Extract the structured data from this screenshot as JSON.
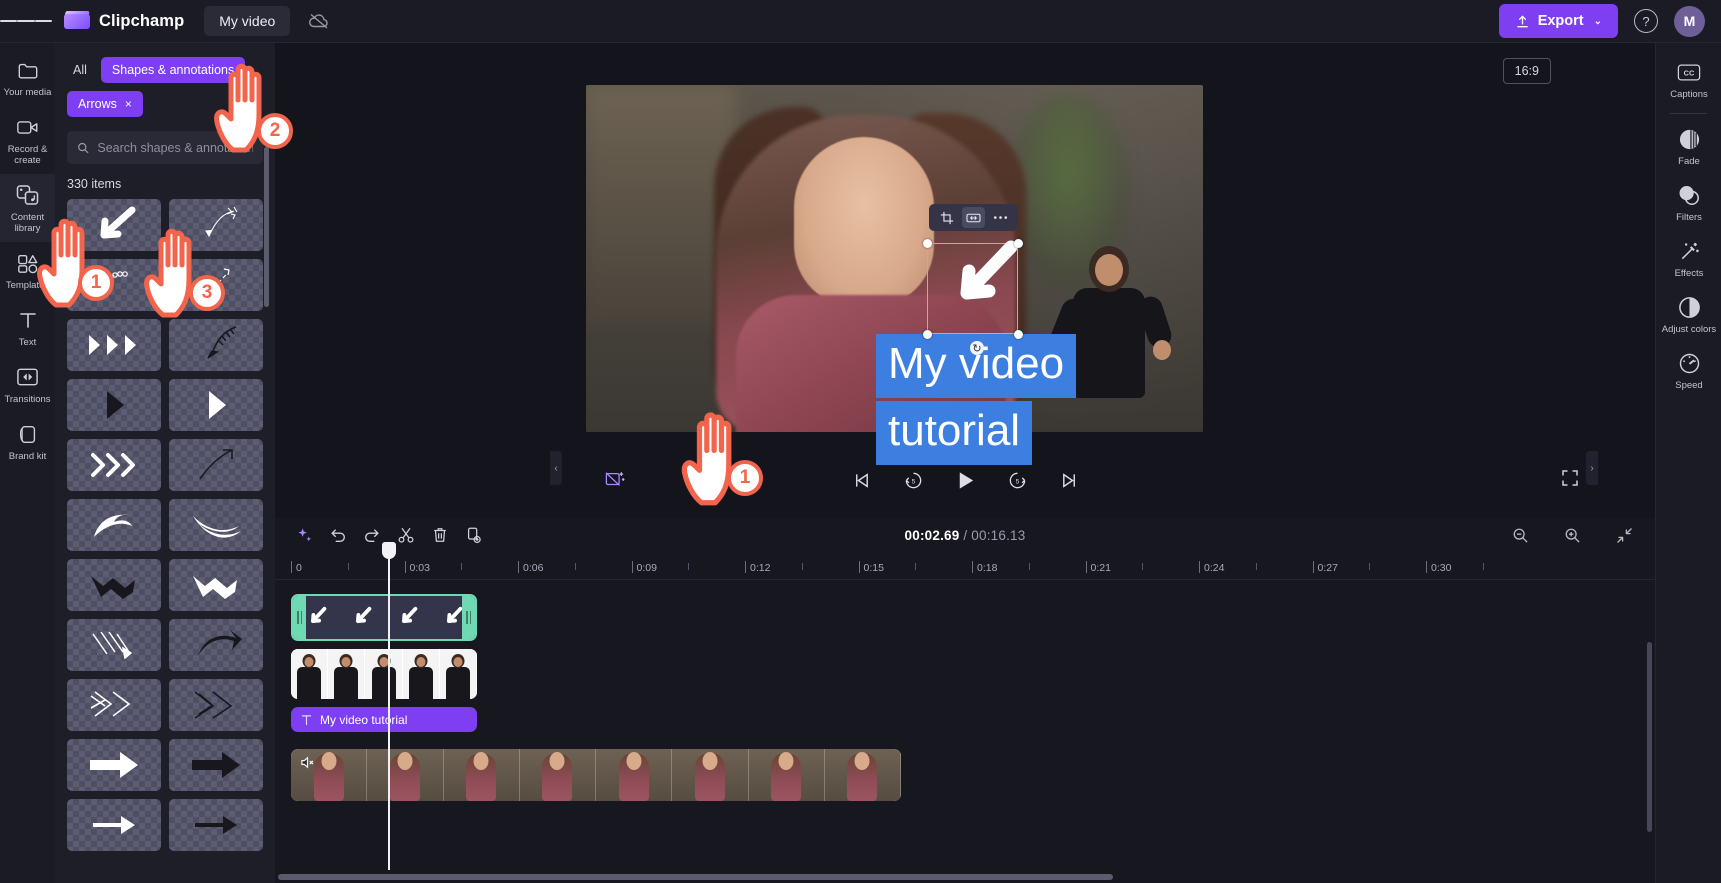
{
  "app": {
    "brand": "Clipchamp",
    "project_name": "My video",
    "menu_icon": "hamburger-icon",
    "cloud_icon": "cloud-offline-icon"
  },
  "topbar": {
    "export_label": "Export",
    "export_icon": "upload-arrow-icon",
    "export_chevron": "⌄",
    "help_icon": "?",
    "avatar_initial": "M",
    "export_color": "#7d3ff1"
  },
  "left_rail": {
    "items": [
      {
        "label": "Your media",
        "icon": "folder-icon",
        "active": false
      },
      {
        "label": "Record & create",
        "icon": "camera-icon",
        "active": false
      },
      {
        "label": "Content library",
        "icon": "dice-music-icon",
        "active": true
      },
      {
        "label": "Templates",
        "icon": "templates-icon",
        "active": false
      },
      {
        "label": "Text",
        "icon": "text-t-icon",
        "active": false
      },
      {
        "label": "Transitions",
        "icon": "transitions-icon",
        "active": false
      },
      {
        "label": "Brand kit",
        "icon": "brand-kit-icon",
        "active": false
      }
    ]
  },
  "library": {
    "filter_all": "All",
    "chips": [
      {
        "label": "Shapes & annotations",
        "removable": false
      },
      {
        "label": "Arrows",
        "removable": true,
        "remove_icon": "×"
      }
    ],
    "search_placeholder": "Search shapes & annotations",
    "search_value": "",
    "search_icon": "search-icon",
    "item_count": "330 items",
    "tiles": [
      {
        "name": "thick-white-arrow-down-left"
      },
      {
        "name": "thin-sketch-arrow-curve"
      },
      {
        "name": "white-squiggle-arrow"
      },
      {
        "name": "dashed-arrow-up-right"
      },
      {
        "name": "triple-white-chevron"
      },
      {
        "name": "black-feather-arrow-curve"
      },
      {
        "name": "black-solid-triangle"
      },
      {
        "name": "white-solid-triangle"
      },
      {
        "name": "white-triple-chevron-right"
      },
      {
        "name": "black-thin-arrow-up-right"
      },
      {
        "name": "white-curved-arrow"
      },
      {
        "name": "white-brush-arrow"
      },
      {
        "name": "black-zigzag-arrow"
      },
      {
        "name": "white-zigzag-arrow"
      },
      {
        "name": "white-sketch-arrow-hatch"
      },
      {
        "name": "black-curved-arrow-right"
      },
      {
        "name": "white-hatched-double-arrow"
      },
      {
        "name": "black-hatched-arrow-down"
      },
      {
        "name": "white-outline-arrow-right"
      },
      {
        "name": "black-outline-arrow-right"
      },
      {
        "name": "white-partial-arrow"
      },
      {
        "name": "black-partial-arrow"
      }
    ]
  },
  "preview": {
    "aspect_ratio": "16:9",
    "selection_toolbar": [
      {
        "name": "crop-icon",
        "active": false
      },
      {
        "name": "fit-width-icon",
        "active": true
      },
      {
        "name": "more-options-icon",
        "active": false
      }
    ],
    "caption_lines": [
      "My video",
      "tutorial"
    ],
    "caption_bg": "#3d7fe0",
    "selection_color": "#6fd9b4",
    "rotate_icon": "rotate-icon"
  },
  "transport": {
    "magic_icon": "magic-eraser-icon",
    "controls": [
      {
        "name": "skip-start-button",
        "icon": "skip-start-icon"
      },
      {
        "name": "rewind-5-button",
        "icon": "back-5-icon",
        "label": "5"
      },
      {
        "name": "play-button",
        "icon": "play-icon"
      },
      {
        "name": "forward-5-button",
        "icon": "forward-5-icon",
        "label": "5"
      },
      {
        "name": "skip-end-button",
        "icon": "skip-end-icon"
      }
    ],
    "fullscreen_icon": "fullscreen-icon"
  },
  "right_rail": {
    "items": [
      {
        "label": "Captions",
        "icon": "cc-icon"
      },
      {
        "label": "Fade",
        "icon": "fade-icon"
      },
      {
        "label": "Filters",
        "icon": "filters-icon"
      },
      {
        "label": "Effects",
        "icon": "effects-wand-icon"
      },
      {
        "label": "Adjust colors",
        "icon": "adjust-colors-icon"
      },
      {
        "label": "Speed",
        "icon": "speed-gauge-icon"
      }
    ]
  },
  "timeline": {
    "toolbar": [
      {
        "name": "ai-suggestions-button",
        "icon": "sparkle-icon"
      },
      {
        "name": "undo-button",
        "icon": "undo-icon"
      },
      {
        "name": "redo-button",
        "icon": "redo-icon"
      },
      {
        "name": "split-button",
        "icon": "scissors-icon"
      },
      {
        "name": "delete-button",
        "icon": "trash-icon"
      },
      {
        "name": "duplicate-button",
        "icon": "duplicate-icon"
      }
    ],
    "current_time": "00:02.69",
    "total_time": "00:16.13",
    "time_separator": "/",
    "zoom_controls": [
      {
        "name": "zoom-out-button",
        "icon": "zoom-out-icon"
      },
      {
        "name": "zoom-in-button",
        "icon": "zoom-in-icon"
      },
      {
        "name": "fit-timeline-button",
        "icon": "fit-icon"
      }
    ],
    "ruler_labels": [
      "0",
      "0:03",
      "0:06",
      "0:09",
      "0:12",
      "0:15",
      "0:18",
      "0:21",
      "0:24",
      "0:27",
      "0:30"
    ],
    "tracks": [
      {
        "name": "arrow-overlay-clip",
        "label": "",
        "selected": true,
        "type": "graphic"
      },
      {
        "name": "boy-overlay-clip",
        "label": "",
        "selected": false,
        "type": "video"
      },
      {
        "name": "text-clip",
        "label": "My video tutorial",
        "selected": false,
        "type": "text",
        "icon": "text-t-icon"
      },
      {
        "name": "main-video-clip",
        "label": "",
        "selected": false,
        "type": "video",
        "icon": "audio-muted-icon"
      }
    ]
  },
  "annotations": [
    {
      "id": "hand-1-library",
      "number": "1"
    },
    {
      "id": "hand-2-chip",
      "number": "2"
    },
    {
      "id": "hand-3-tile",
      "number": "3"
    },
    {
      "id": "hand-1-canvas",
      "number": "1"
    }
  ]
}
